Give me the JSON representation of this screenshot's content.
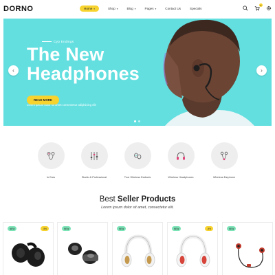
{
  "header": {
    "logo": "DORNO",
    "nav": [
      {
        "label": "Home",
        "caret": "▾",
        "active": true
      },
      {
        "label": "Shop",
        "caret": "▾"
      },
      {
        "label": "Blog",
        "caret": "▾"
      },
      {
        "label": "Pages",
        "caret": "▾"
      },
      {
        "label": "Contact Us",
        "caret": ""
      },
      {
        "label": "Specials",
        "caret": ""
      }
    ],
    "cart_count": "0",
    "icons": [
      "search-icon",
      "cart-icon",
      "settings-icon"
    ]
  },
  "hero": {
    "tag": "Cyp Endings",
    "title_line1": "The New",
    "title_line2": "Headphones",
    "subtitle": "Lorem ipsum dolor sit amet consectetur adipisicing elit",
    "button": "READ MORE",
    "background": "#63dfe0",
    "prev_arrow": "‹",
    "next_arrow": "›"
  },
  "categories": [
    {
      "label": "In Ears",
      "icon": "in-ear-icon"
    },
    {
      "label": "Studio & Professional",
      "icon": "mixer-icon"
    },
    {
      "label": "True Wireless Earbuds",
      "icon": "earbuds-icon"
    },
    {
      "label": "Wireless Headphones",
      "icon": "headphones-icon"
    },
    {
      "label": "Wireless Earphone",
      "icon": "earphone-icon"
    }
  ],
  "best_seller": {
    "title_light": "Best ",
    "title_bold": "Seller Products",
    "subtitle": "Lorem ipsum dolor sit amet, consectetur elit."
  },
  "products": [
    {
      "badge_new": "NEW",
      "badge_sale": "-9%",
      "image": "black-earbuds"
    },
    {
      "badge_new": "NEW",
      "badge_sale": "",
      "image": "wireless-earbuds-case"
    },
    {
      "badge_new": "NEW",
      "badge_sale": "",
      "image": "white-headphones"
    },
    {
      "badge_new": "NEW",
      "badge_sale": "-9%",
      "image": "red-headphones"
    },
    {
      "badge_new": "NEW",
      "badge_sale": "",
      "image": "red-sport-earphones"
    }
  ],
  "colors": {
    "accent": "#f7d32f",
    "hero": "#63dfe0",
    "new_badge": "#7ce3b7"
  }
}
